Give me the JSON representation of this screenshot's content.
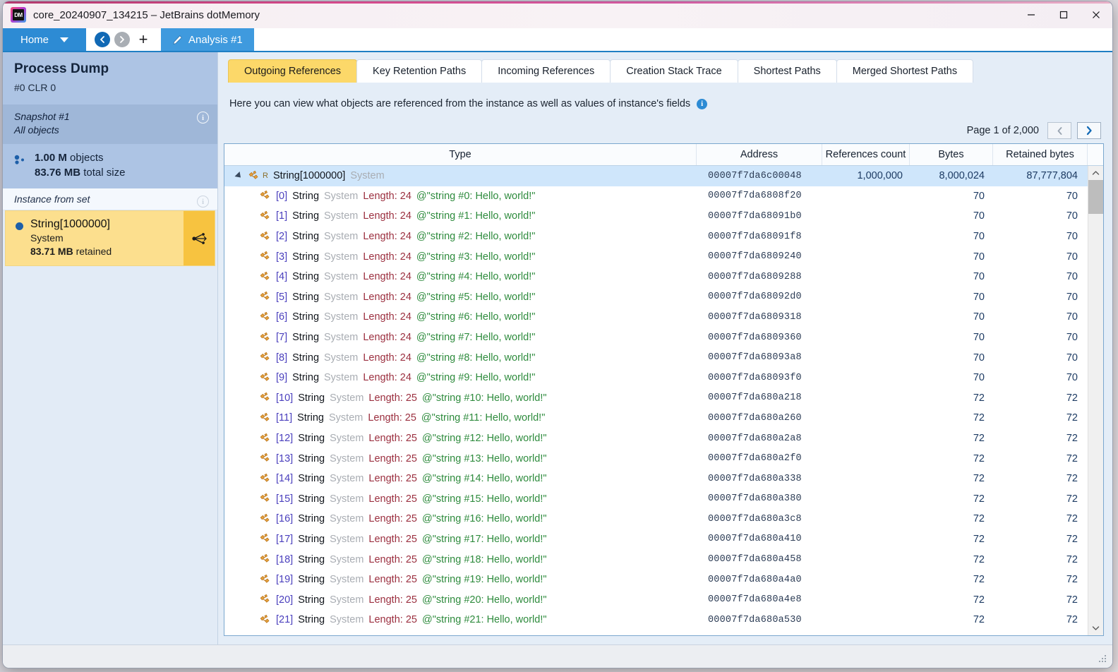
{
  "window": {
    "title": "core_20240907_134215 – JetBrains dotMemory",
    "logo_text": "DM",
    "controls": {
      "minimize": "minimize-icon",
      "maximize": "maximize-icon",
      "close": "close-icon"
    }
  },
  "tabstrip": {
    "home_label": "Home",
    "back_icon": "back-arrow-icon",
    "forward_icon": "forward-arrow-icon",
    "add_label": "+",
    "analysis_tab": "Analysis #1",
    "analysis_icon": "pencil-icon"
  },
  "sidebar": {
    "process": {
      "title": "Process Dump",
      "subtitle": "#0 CLR 0"
    },
    "snapshot": {
      "line1": "Snapshot #1",
      "line2": "All objects",
      "info_icon": "info-icon"
    },
    "stats": {
      "objects_value": "1.00 M",
      "objects_label": "objects",
      "size_value": "83.76 MB",
      "size_label": "total size",
      "icon": "objects-icon"
    },
    "instance_header": {
      "label": "Instance from set",
      "info_icon": "info-icon"
    },
    "selected_instance": {
      "name": "String[1000000]",
      "namespace": "System",
      "retained_value": "83.71 MB",
      "retained_label": "retained",
      "share_icon": "share-nodes-icon"
    }
  },
  "main": {
    "tabs": [
      {
        "label": "Outgoing References",
        "active": true
      },
      {
        "label": "Key Retention Paths",
        "active": false
      },
      {
        "label": "Incoming References",
        "active": false
      },
      {
        "label": "Creation Stack Trace",
        "active": false
      },
      {
        "label": "Shortest Paths",
        "active": false
      },
      {
        "label": "Merged Shortest Paths",
        "active": false
      }
    ],
    "description": "Here you can view what objects are referenced from the instance as well as values of instance's fields",
    "description_info_icon": "info-icon",
    "pager": {
      "text": "Page 1 of 2,000",
      "prev_icon": "chevron-left-icon",
      "next_icon": "chevron-right-icon"
    },
    "table": {
      "columns": [
        "Type",
        "Address",
        "References count",
        "Bytes",
        "Retained bytes"
      ],
      "rows": [
        {
          "selected": true,
          "expander": true,
          "icon": "reference-icon",
          "root_marker": "R",
          "name": "String[1000000]",
          "namespace": "System",
          "length": "",
          "value": "",
          "address": "00007f7da6c00048",
          "refs": "1,000,000",
          "bytes": "8,000,024",
          "retained": "87,777,804"
        },
        {
          "selected": false,
          "expander": false,
          "icon": "reference-icon",
          "index": "[0]",
          "name": "String",
          "namespace": "System",
          "length": "Length: 24",
          "value": "@\"string #0: Hello, world!\"",
          "address": "00007f7da6808f20",
          "refs": "",
          "bytes": "70",
          "retained": "70"
        },
        {
          "selected": false,
          "expander": false,
          "icon": "reference-icon",
          "index": "[1]",
          "name": "String",
          "namespace": "System",
          "length": "Length: 24",
          "value": "@\"string #1: Hello, world!\"",
          "address": "00007f7da68091b0",
          "refs": "",
          "bytes": "70",
          "retained": "70"
        },
        {
          "selected": false,
          "expander": false,
          "icon": "reference-icon",
          "index": "[2]",
          "name": "String",
          "namespace": "System",
          "length": "Length: 24",
          "value": "@\"string #2: Hello, world!\"",
          "address": "00007f7da68091f8",
          "refs": "",
          "bytes": "70",
          "retained": "70"
        },
        {
          "selected": false,
          "expander": false,
          "icon": "reference-icon",
          "index": "[3]",
          "name": "String",
          "namespace": "System",
          "length": "Length: 24",
          "value": "@\"string #3: Hello, world!\"",
          "address": "00007f7da6809240",
          "refs": "",
          "bytes": "70",
          "retained": "70"
        },
        {
          "selected": false,
          "expander": false,
          "icon": "reference-icon",
          "index": "[4]",
          "name": "String",
          "namespace": "System",
          "length": "Length: 24",
          "value": "@\"string #4: Hello, world!\"",
          "address": "00007f7da6809288",
          "refs": "",
          "bytes": "70",
          "retained": "70"
        },
        {
          "selected": false,
          "expander": false,
          "icon": "reference-icon",
          "index": "[5]",
          "name": "String",
          "namespace": "System",
          "length": "Length: 24",
          "value": "@\"string #5: Hello, world!\"",
          "address": "00007f7da68092d0",
          "refs": "",
          "bytes": "70",
          "retained": "70"
        },
        {
          "selected": false,
          "expander": false,
          "icon": "reference-icon",
          "index": "[6]",
          "name": "String",
          "namespace": "System",
          "length": "Length: 24",
          "value": "@\"string #6: Hello, world!\"",
          "address": "00007f7da6809318",
          "refs": "",
          "bytes": "70",
          "retained": "70"
        },
        {
          "selected": false,
          "expander": false,
          "icon": "reference-icon",
          "index": "[7]",
          "name": "String",
          "namespace": "System",
          "length": "Length: 24",
          "value": "@\"string #7: Hello, world!\"",
          "address": "00007f7da6809360",
          "refs": "",
          "bytes": "70",
          "retained": "70"
        },
        {
          "selected": false,
          "expander": false,
          "icon": "reference-icon",
          "index": "[8]",
          "name": "String",
          "namespace": "System",
          "length": "Length: 24",
          "value": "@\"string #8: Hello, world!\"",
          "address": "00007f7da68093a8",
          "refs": "",
          "bytes": "70",
          "retained": "70"
        },
        {
          "selected": false,
          "expander": false,
          "icon": "reference-icon",
          "index": "[9]",
          "name": "String",
          "namespace": "System",
          "length": "Length: 24",
          "value": "@\"string #9: Hello, world!\"",
          "address": "00007f7da68093f0",
          "refs": "",
          "bytes": "70",
          "retained": "70"
        },
        {
          "selected": false,
          "expander": false,
          "icon": "reference-icon",
          "index": "[10]",
          "name": "String",
          "namespace": "System",
          "length": "Length: 25",
          "value": "@\"string #10: Hello, world!\"",
          "address": "00007f7da680a218",
          "refs": "",
          "bytes": "72",
          "retained": "72"
        },
        {
          "selected": false,
          "expander": false,
          "icon": "reference-icon",
          "index": "[11]",
          "name": "String",
          "namespace": "System",
          "length": "Length: 25",
          "value": "@\"string #11: Hello, world!\"",
          "address": "00007f7da680a260",
          "refs": "",
          "bytes": "72",
          "retained": "72"
        },
        {
          "selected": false,
          "expander": false,
          "icon": "reference-icon",
          "index": "[12]",
          "name": "String",
          "namespace": "System",
          "length": "Length: 25",
          "value": "@\"string #12: Hello, world!\"",
          "address": "00007f7da680a2a8",
          "refs": "",
          "bytes": "72",
          "retained": "72"
        },
        {
          "selected": false,
          "expander": false,
          "icon": "reference-icon",
          "index": "[13]",
          "name": "String",
          "namespace": "System",
          "length": "Length: 25",
          "value": "@\"string #13: Hello, world!\"",
          "address": "00007f7da680a2f0",
          "refs": "",
          "bytes": "72",
          "retained": "72"
        },
        {
          "selected": false,
          "expander": false,
          "icon": "reference-icon",
          "index": "[14]",
          "name": "String",
          "namespace": "System",
          "length": "Length: 25",
          "value": "@\"string #14: Hello, world!\"",
          "address": "00007f7da680a338",
          "refs": "",
          "bytes": "72",
          "retained": "72"
        },
        {
          "selected": false,
          "expander": false,
          "icon": "reference-icon",
          "index": "[15]",
          "name": "String",
          "namespace": "System",
          "length": "Length: 25",
          "value": "@\"string #15: Hello, world!\"",
          "address": "00007f7da680a380",
          "refs": "",
          "bytes": "72",
          "retained": "72"
        },
        {
          "selected": false,
          "expander": false,
          "icon": "reference-icon",
          "index": "[16]",
          "name": "String",
          "namespace": "System",
          "length": "Length: 25",
          "value": "@\"string #16: Hello, world!\"",
          "address": "00007f7da680a3c8",
          "refs": "",
          "bytes": "72",
          "retained": "72"
        },
        {
          "selected": false,
          "expander": false,
          "icon": "reference-icon",
          "index": "[17]",
          "name": "String",
          "namespace": "System",
          "length": "Length: 25",
          "value": "@\"string #17: Hello, world!\"",
          "address": "00007f7da680a410",
          "refs": "",
          "bytes": "72",
          "retained": "72"
        },
        {
          "selected": false,
          "expander": false,
          "icon": "reference-icon",
          "index": "[18]",
          "name": "String",
          "namespace": "System",
          "length": "Length: 25",
          "value": "@\"string #18: Hello, world!\"",
          "address": "00007f7da680a458",
          "refs": "",
          "bytes": "72",
          "retained": "72"
        },
        {
          "selected": false,
          "expander": false,
          "icon": "reference-icon",
          "index": "[19]",
          "name": "String",
          "namespace": "System",
          "length": "Length: 25",
          "value": "@\"string #19: Hello, world!\"",
          "address": "00007f7da680a4a0",
          "refs": "",
          "bytes": "72",
          "retained": "72"
        },
        {
          "selected": false,
          "expander": false,
          "icon": "reference-icon",
          "index": "[20]",
          "name": "String",
          "namespace": "System",
          "length": "Length: 25",
          "value": "@\"string #20: Hello, world!\"",
          "address": "00007f7da680a4e8",
          "refs": "",
          "bytes": "72",
          "retained": "72"
        },
        {
          "selected": false,
          "expander": false,
          "icon": "reference-icon",
          "index": "[21]",
          "name": "String",
          "namespace": "System",
          "length": "Length: 25",
          "value": "@\"string #21: Hello, world!\"",
          "address": "00007f7da680a530",
          "refs": "",
          "bytes": "72",
          "retained": "72"
        }
      ]
    }
  },
  "colors": {
    "accent_blue": "#2d8bd4",
    "tab_active_yellow": "#fcd869",
    "selection_blue": "#cfe6fb",
    "sidebar_blue": "#adc4e4",
    "selected_instance_yellow": "#fcdf8e"
  }
}
